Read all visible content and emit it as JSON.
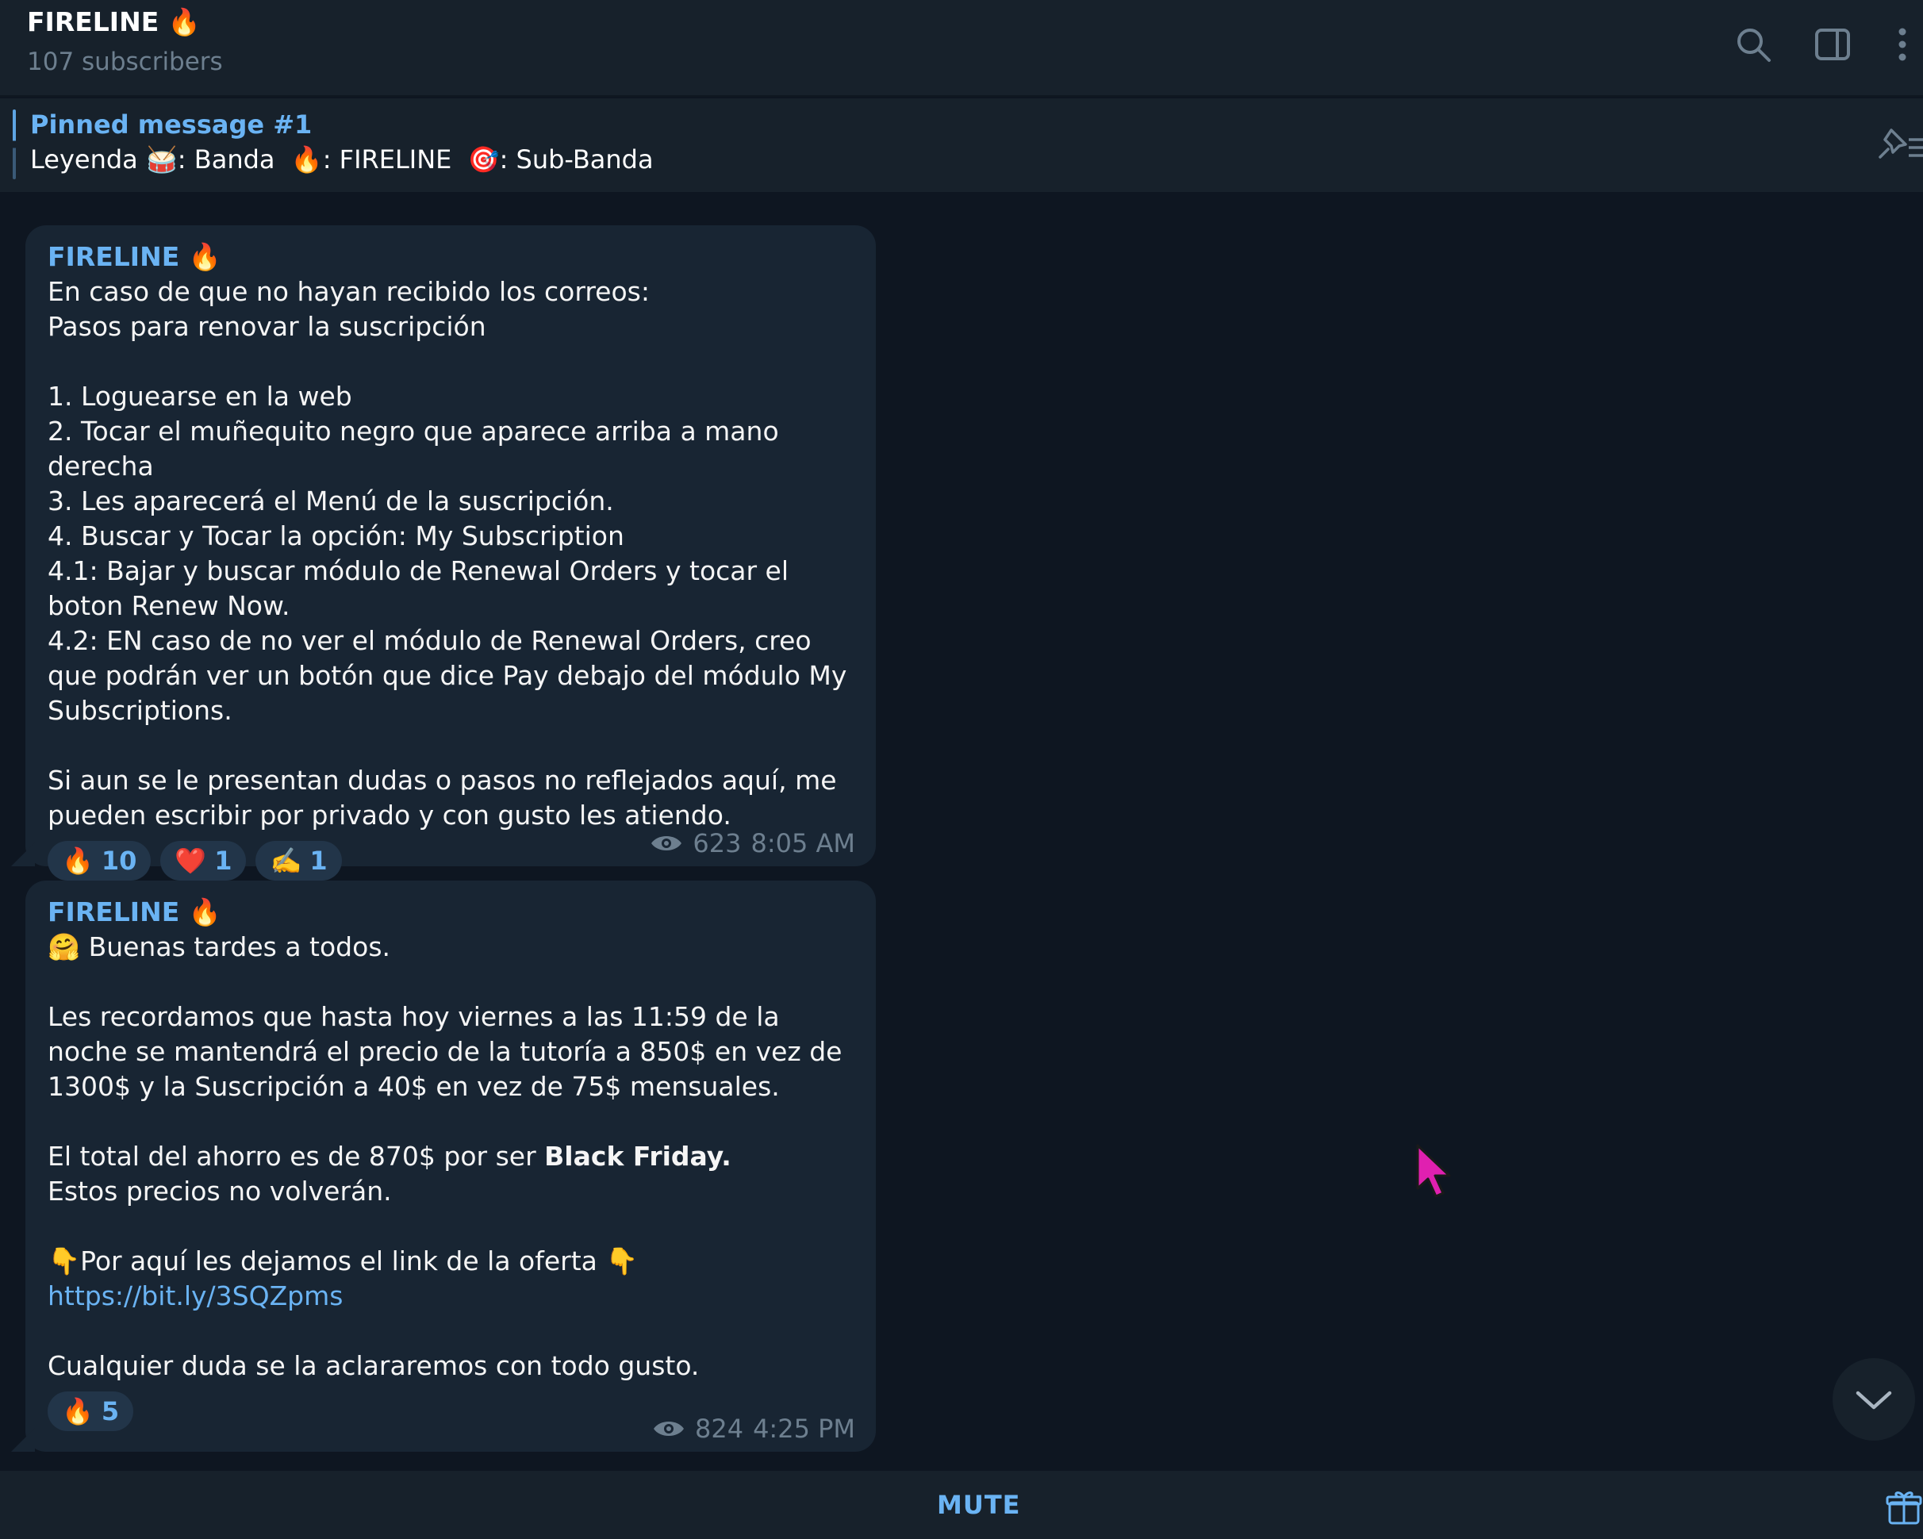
{
  "header": {
    "title": "FIRELINE 🔥",
    "subtitle": "107 subscribers",
    "icons": [
      "search-icon",
      "sidebar-toggle-icon",
      "more-icon"
    ]
  },
  "pinned": {
    "title": "Pinned message #1",
    "text": "Leyenda 🥁: Banda  🔥: FIRELINE  🎯: Sub-Banda"
  },
  "messages": [
    {
      "sender": "FIRELINE 🔥",
      "body": "En caso de que no hayan recibido los correos:\nPasos para renovar la suscripción\n\n1. Loguearse en la web\n2. Tocar el muñequito negro que aparece arriba a mano derecha\n3. Les aparecerá el Menú de la suscripción.\n4. Buscar y Tocar la opción: My Subscription\n4.1: Bajar y buscar módulo de Renewal Orders y tocar el boton Renew Now.\n4.2: EN caso de no ver el módulo de Renewal Orders, creo que podrán ver un botón que dice Pay debajo del módulo My Subscriptions.\n\nSi aun se le presentan dudas o pasos no reflejados aquí, me pueden escribir por privado y con gusto les atiendo.",
      "reactions": [
        {
          "emoji": "🔥",
          "count": "10"
        },
        {
          "emoji": "❤️",
          "count": "1"
        },
        {
          "emoji": "✍️",
          "count": "1"
        }
      ],
      "views": "623",
      "time": "8:05 AM"
    },
    {
      "sender": "FIRELINE 🔥",
      "body_part1": "🤗 Buenas tardes a todos.\n\nLes recordamos que hasta hoy viernes a las 11:59 de la noche se mantendrá el precio de la tutoría a 850$ en vez de 1300$ y la Suscripción a 40$ en vez de 75$ mensuales.\n\nEl total del ahorro es de 870$ por ser ",
      "body_bold": "Black Friday.",
      "body_part2": "\nEstos precios no volverán.\n\n👇Por aquí les dejamos el link de la oferta 👇\n",
      "link": "https://bit.ly/3SQZpms",
      "body_part3": "\n\nCualquier duda se la aclararemos con todo gusto.",
      "reactions": [
        {
          "emoji": "🔥",
          "count": "5"
        }
      ],
      "views": "824",
      "time": "4:25 PM"
    }
  ],
  "bottom": {
    "mute_label": "MUTE"
  },
  "colors": {
    "background": "#0e1621",
    "panel": "#17212b",
    "bubble": "#182533",
    "accent": "#6ab3f3",
    "muted": "#6d7f8f",
    "cursor": "#e020b0"
  }
}
